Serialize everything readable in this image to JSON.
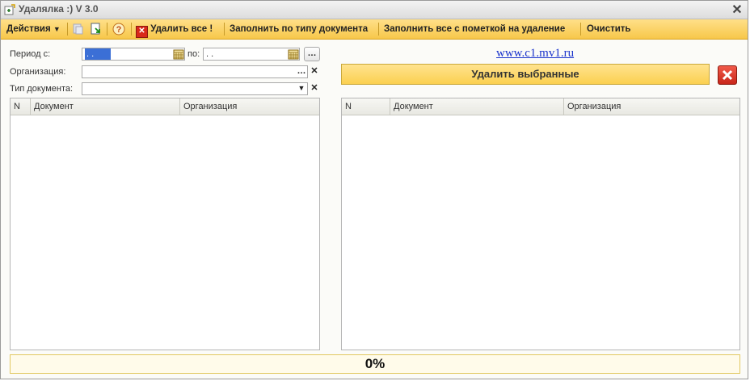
{
  "window": {
    "title": "Удалялка :)  V 3.0"
  },
  "toolbar": {
    "actions": "Действия",
    "delete_all": "Удалить все !",
    "fill_by_type": "Заполнить по типу документа",
    "fill_marked": "Заполнить все с пометкой на удаление",
    "clear": "Очистить"
  },
  "filters": {
    "period_from_label": "Период с:",
    "period_from_value": " .  .",
    "period_to_label": "по:",
    "period_to_value": " .  .",
    "organization_label": "Организация:",
    "doc_type_label": "Тип документа:"
  },
  "left_table": {
    "columns": [
      "N",
      "Документ",
      "Организация"
    ]
  },
  "right_panel": {
    "link": "www.c1.mv1.ru",
    "delete_selected": "Удалить выбранные",
    "columns": [
      "N",
      "Документ",
      "Организация"
    ]
  },
  "progress": {
    "value": 0,
    "label": "0%"
  }
}
